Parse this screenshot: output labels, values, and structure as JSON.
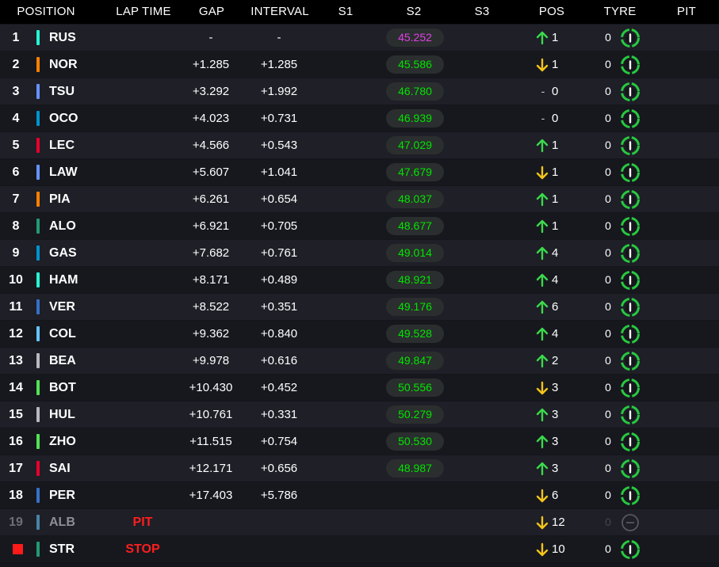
{
  "headers": {
    "position": "POSITION",
    "lap_time": "LAP TIME",
    "gap": "GAP",
    "interval": "INTERVAL",
    "s1": "S1",
    "s2": "S2",
    "s3": "S3",
    "pos": "POS",
    "tyre": "TYRE",
    "pit": "PIT"
  },
  "colors": {
    "green": "#00e600",
    "purple": "#e040e8",
    "up_arrow": "#3bd94b",
    "down_arrow": "#f5c518",
    "status_red": "#ff1e1e"
  },
  "rows": [
    {
      "pos": "1",
      "code": "RUS",
      "team_color": "#27f4d2",
      "gap": "-",
      "interval": "-",
      "s2": "45.252",
      "s2_color": "purple",
      "pos_dir": "up",
      "pos_change": "1",
      "tyre_count": "0",
      "tyre_icon": "hard-tyre-icon"
    },
    {
      "pos": "2",
      "code": "NOR",
      "team_color": "#ff8000",
      "gap": "+1.285",
      "interval": "+1.285",
      "s2": "45.586",
      "s2_color": "green",
      "pos_dir": "down",
      "pos_change": "1",
      "tyre_count": "0",
      "tyre_icon": "hard-tyre-icon"
    },
    {
      "pos": "3",
      "code": "TSU",
      "team_color": "#6692ff",
      "gap": "+3.292",
      "interval": "+1.992",
      "s2": "46.780",
      "s2_color": "green",
      "pos_dir": "none",
      "pos_change": "0",
      "tyre_count": "0",
      "tyre_icon": "hard-tyre-icon"
    },
    {
      "pos": "4",
      "code": "OCO",
      "team_color": "#0093cc",
      "gap": "+4.023",
      "interval": "+0.731",
      "s2": "46.939",
      "s2_color": "green",
      "pos_dir": "none",
      "pos_change": "0",
      "tyre_count": "0",
      "tyre_icon": "hard-tyre-icon"
    },
    {
      "pos": "5",
      "code": "LEC",
      "team_color": "#e8002d",
      "gap": "+4.566",
      "interval": "+0.543",
      "s2": "47.029",
      "s2_color": "green",
      "pos_dir": "up",
      "pos_change": "1",
      "tyre_count": "0",
      "tyre_icon": "hard-tyre-icon"
    },
    {
      "pos": "6",
      "code": "LAW",
      "team_color": "#6692ff",
      "gap": "+5.607",
      "interval": "+1.041",
      "s2": "47.679",
      "s2_color": "green",
      "pos_dir": "down",
      "pos_change": "1",
      "tyre_count": "0",
      "tyre_icon": "hard-tyre-icon"
    },
    {
      "pos": "7",
      "code": "PIA",
      "team_color": "#ff8000",
      "gap": "+6.261",
      "interval": "+0.654",
      "s2": "48.037",
      "s2_color": "green",
      "pos_dir": "up",
      "pos_change": "1",
      "tyre_count": "0",
      "tyre_icon": "hard-tyre-icon"
    },
    {
      "pos": "8",
      "code": "ALO",
      "team_color": "#229971",
      "gap": "+6.921",
      "interval": "+0.705",
      "s2": "48.677",
      "s2_color": "green",
      "pos_dir": "up",
      "pos_change": "1",
      "tyre_count": "0",
      "tyre_icon": "hard-tyre-icon"
    },
    {
      "pos": "9",
      "code": "GAS",
      "team_color": "#0093cc",
      "gap": "+7.682",
      "interval": "+0.761",
      "s2": "49.014",
      "s2_color": "green",
      "pos_dir": "up",
      "pos_change": "4",
      "tyre_count": "0",
      "tyre_icon": "hard-tyre-icon"
    },
    {
      "pos": "10",
      "code": "HAM",
      "team_color": "#27f4d2",
      "gap": "+8.171",
      "interval": "+0.489",
      "s2": "48.921",
      "s2_color": "green",
      "pos_dir": "up",
      "pos_change": "4",
      "tyre_count": "0",
      "tyre_icon": "hard-tyre-icon"
    },
    {
      "pos": "11",
      "code": "VER",
      "team_color": "#3671c6",
      "gap": "+8.522",
      "interval": "+0.351",
      "s2": "49.176",
      "s2_color": "green",
      "pos_dir": "up",
      "pos_change": "6",
      "tyre_count": "0",
      "tyre_icon": "hard-tyre-icon"
    },
    {
      "pos": "12",
      "code": "COL",
      "team_color": "#64c4ff",
      "gap": "+9.362",
      "interval": "+0.840",
      "s2": "49.528",
      "s2_color": "green",
      "pos_dir": "up",
      "pos_change": "4",
      "tyre_count": "0",
      "tyre_icon": "hard-tyre-icon"
    },
    {
      "pos": "13",
      "code": "BEA",
      "team_color": "#b6babd",
      "gap": "+9.978",
      "interval": "+0.616",
      "s2": "49.847",
      "s2_color": "green",
      "pos_dir": "up",
      "pos_change": "2",
      "tyre_count": "0",
      "tyre_icon": "hard-tyre-icon"
    },
    {
      "pos": "14",
      "code": "BOT",
      "team_color": "#52e252",
      "gap": "+10.430",
      "interval": "+0.452",
      "s2": "50.556",
      "s2_color": "green",
      "pos_dir": "down",
      "pos_change": "3",
      "tyre_count": "0",
      "tyre_icon": "hard-tyre-icon"
    },
    {
      "pos": "15",
      "code": "HUL",
      "team_color": "#b6babd",
      "gap": "+10.761",
      "interval": "+0.331",
      "s2": "50.279",
      "s2_color": "green",
      "pos_dir": "up",
      "pos_change": "3",
      "tyre_count": "0",
      "tyre_icon": "hard-tyre-icon"
    },
    {
      "pos": "16",
      "code": "ZHO",
      "team_color": "#52e252",
      "gap": "+11.515",
      "interval": "+0.754",
      "s2": "50.530",
      "s2_color": "green",
      "pos_dir": "up",
      "pos_change": "3",
      "tyre_count": "0",
      "tyre_icon": "hard-tyre-icon"
    },
    {
      "pos": "17",
      "code": "SAI",
      "team_color": "#e8002d",
      "gap": "+12.171",
      "interval": "+0.656",
      "s2": "48.987",
      "s2_color": "green",
      "pos_dir": "up",
      "pos_change": "3",
      "tyre_count": "0",
      "tyre_icon": "hard-tyre-icon"
    },
    {
      "pos": "18",
      "code": "PER",
      "team_color": "#3671c6",
      "gap": "+17.403",
      "interval": "+5.786",
      "s2": "",
      "s2_color": "green",
      "pos_dir": "down",
      "pos_change": "6",
      "tyre_count": "0",
      "tyre_icon": "hard-tyre-icon"
    },
    {
      "pos": "19",
      "code": "ALB",
      "team_color": "#64c4ff",
      "status": "PIT",
      "gap": "",
      "interval": "",
      "s2": "",
      "s2_color": "green",
      "pos_dir": "down",
      "pos_change": "12",
      "tyre_count": "0",
      "tyre_icon": "unknown-tyre-icon",
      "dim": true
    },
    {
      "pos": "",
      "code": "STR",
      "team_color": "#229971",
      "status": "STOP",
      "stopped": true,
      "gap": "",
      "interval": "",
      "s2": "",
      "s2_color": "green",
      "pos_dir": "down",
      "pos_change": "10",
      "tyre_count": "0",
      "tyre_icon": "hard-tyre-icon"
    }
  ]
}
